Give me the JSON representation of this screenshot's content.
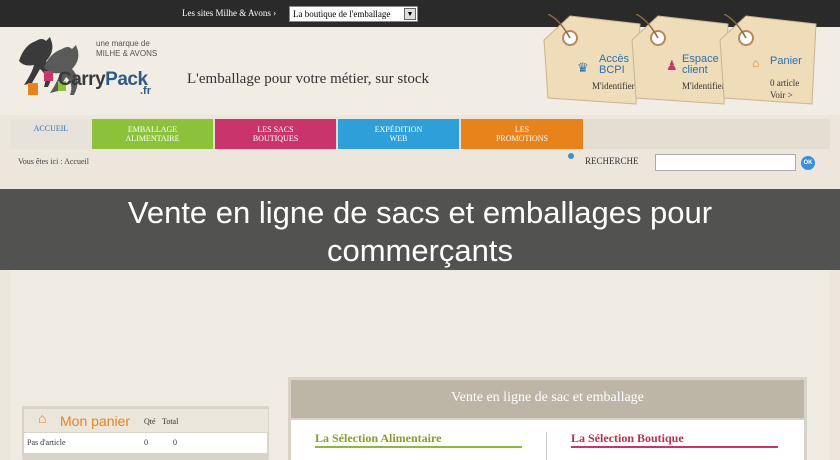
{
  "topbar": {
    "sites_label": "Les sites Milhe & Avons ›",
    "select_value": "La boutique de l'emballage"
  },
  "header": {
    "brand_sub": "une marque de MILHE & AVONS",
    "brand_carry": "Carry",
    "brand_pack": "Pack",
    "brand_fr": ".fr",
    "slogan": "L'emballage pour votre métier, sur stock"
  },
  "tags": [
    {
      "title": "Accès BCPI",
      "link": "M'identifier >",
      "icon": "crown-icon"
    },
    {
      "title": "Espace client",
      "link": "M'identifier >",
      "icon": "user-icon"
    },
    {
      "title": "Panier",
      "link1": "0 article",
      "link2": "Voir >",
      "icon": "basket-icon"
    }
  ],
  "nav": {
    "home": "ACCUEIL",
    "items": [
      {
        "line1": "EMBALLAGE",
        "line2": "ALIMENTAIRE",
        "color": "#8cc23a"
      },
      {
        "line1": "LES SACS",
        "line2": "BOUTIQUES",
        "color": "#c9356a"
      },
      {
        "line1": "EXPÉDITION",
        "line2": "WEB",
        "color": "#2e9fd8"
      },
      {
        "line1": "LES",
        "line2": "PROMOTIONS",
        "color": "#e8831c"
      }
    ]
  },
  "breadcrumb": "Vous êtes ici : Accueil",
  "search": {
    "label": "RECHERCHE",
    "ok": "OK"
  },
  "overlay_title": "Vente en ligne de sacs et emballages pour commerçants",
  "cart": {
    "title": "Mon panier",
    "qte": "Qté",
    "total": "Total",
    "row_label": "Pas d'article",
    "row_qte": "0",
    "row_total": "0"
  },
  "panel": {
    "title": "Vente en ligne de sac et emballage",
    "food": "La Sélection Alimentaire",
    "shop": "La Sélection Boutique"
  },
  "colors": {
    "accent_blue": "#2d6fb0",
    "tag_bg": "#efdcb8",
    "orange": "#e8831c"
  }
}
